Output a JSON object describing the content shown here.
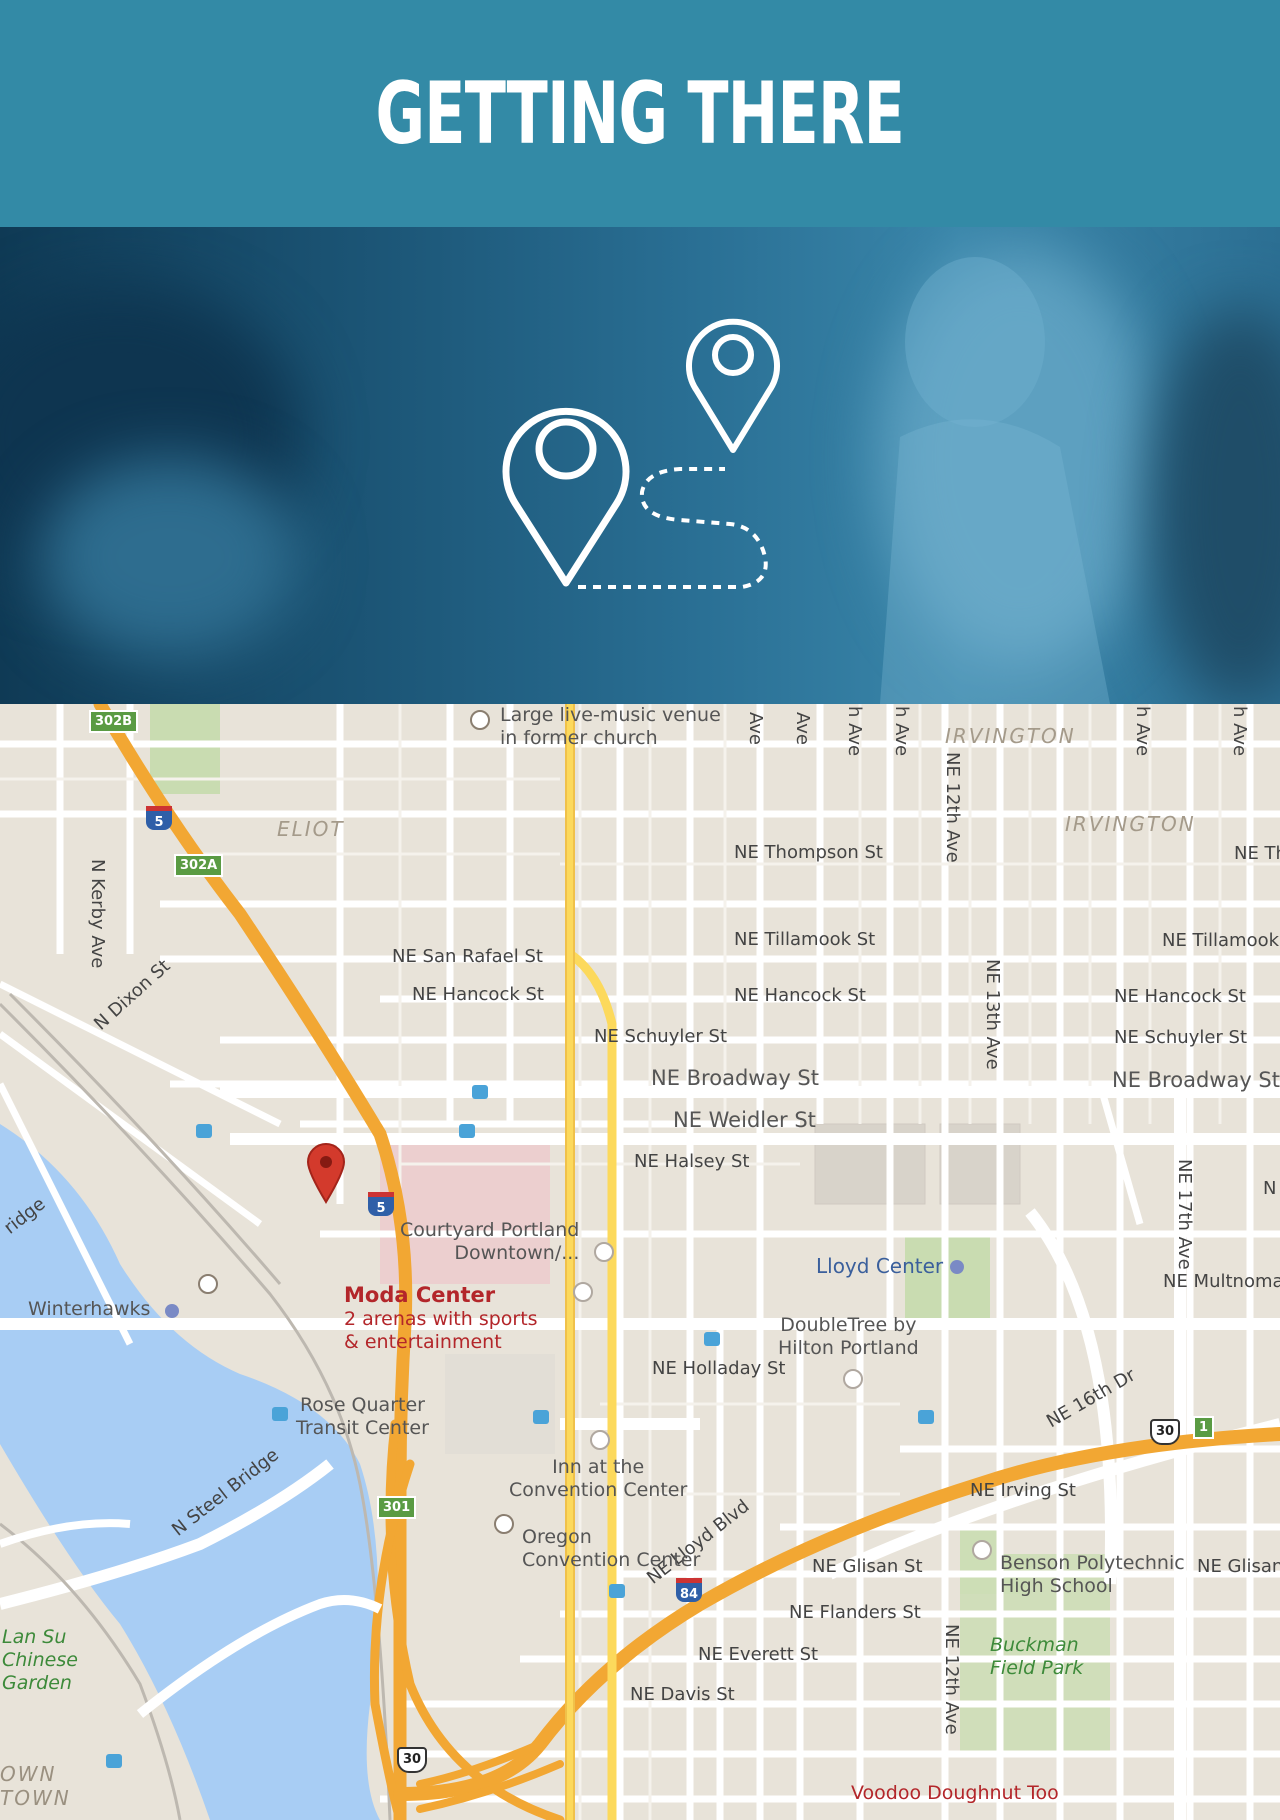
{
  "header": {
    "title": "GETTING THERE"
  },
  "hero": {
    "icon": "location-pins-route-icon"
  },
  "map": {
    "neighborhoods": [
      "ELIOT",
      "IRVINGTON",
      "IRVINGTON"
    ],
    "streets": {
      "kerby": "N Kerby Ave",
      "dixon": "N Dixon St",
      "san_rafael": "NE San Rafael St",
      "hancock1": "NE Hancock St",
      "hancock2": "NE Hancock St",
      "hancock3": "NE Hancock St",
      "schuyler1": "NE Schuyler St",
      "schuyler2": "NE Schuyler St",
      "broadway1": "NE Broadway St",
      "broadway2": "NE Broadway St",
      "weidler": "NE Weidler St",
      "halsey": "NE Halsey St",
      "thompson": "NE Thompson St",
      "tillamook1": "NE Tillamook St",
      "tillamook2": "NE Tillamook",
      "ne12_top": "NE 12th Ave",
      "ne13": "NE 13th Ave",
      "ne17": "NE 17th Ave",
      "ne12_bot": "NE 12th Ave",
      "holladay": "NE Holladay St",
      "ne16dr": "NE 16th Dr",
      "multnomah": "NE Multnoma",
      "irving": "NE Irving St",
      "glisan1": "NE Glisan St",
      "glisan2": "NE Glisan",
      "flanders": "NE Flanders St",
      "everett": "NE Everett St",
      "davis": "NE Davis St",
      "lloyd_blvd": "NE Lloyd Blvd",
      "steel_bridge": "N Steel Bridge",
      "bridge_left": "ridge",
      "ne_th": "NE Th",
      "ave1": "Ave",
      "ave2": "Ave",
      "ave3": "h Ave",
      "ave4": "h Ave",
      "ave5": "h Ave",
      "ave6": "h Ave",
      "ave7": "N"
    },
    "pois": {
      "music_venue": "Large live-music venue\nin former church",
      "courtyard": "Courtyard Portland\nDowntown/...",
      "moda_name": "Moda Center",
      "moda_desc": "2 arenas with sports\n& entertainment",
      "winterhawks": "Winterhawks",
      "lloyd_center": "Lloyd Center",
      "doubletree": "DoubleTree by\nHilton Portland",
      "rose_quarter": "Rose Quarter\nTransit Center",
      "inn": "Inn at the\nConvention Center",
      "oregon_cc": "Oregon\nConvention Center",
      "benson": "Benson Polytechnic\nHigh School",
      "buckman": "Buckman\nField Park",
      "lan_su": "Lan Su\nChinese\nGarden",
      "voodoo": "Voodoo Doughnut Too",
      "downtown": "OWN\nTOWN"
    },
    "shields": [
      "302B",
      "302A",
      "5",
      "5",
      "301",
      "84",
      "30",
      "30",
      "1"
    ]
  }
}
